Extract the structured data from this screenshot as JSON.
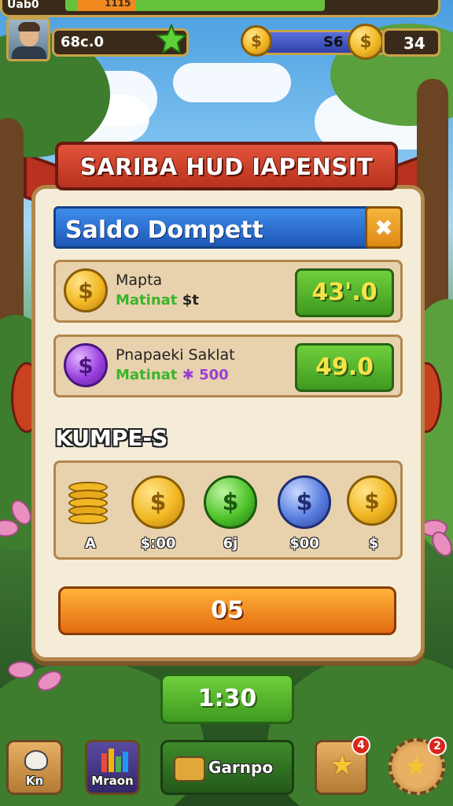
{
  "top": {
    "strip_label": "Uab0",
    "strip_value": "1115",
    "player_name": "68c.0",
    "currency_value": "S6",
    "count_value": "34"
  },
  "modal": {
    "ribbon_title": "SARIBA HUD IAPENSIT",
    "header_title": "Saldo Dompett",
    "close_label": "✖",
    "rows": [
      {
        "name": "Mapta",
        "sub_prefix": "Matinat",
        "sub_value": "$t",
        "button_value": "43'.0",
        "coin_color": "gold"
      },
      {
        "name": "Pnapaeki Saklat",
        "sub_prefix": "Matinat",
        "sub_value": "500",
        "button_value": "49.0",
        "coin_color": "purple"
      }
    ],
    "section_title": "KUMPE-S",
    "coins": [
      {
        "label": "A",
        "kind": "stack"
      },
      {
        "label": "$:00",
        "kind": "gold"
      },
      {
        "label": "6j",
        "kind": "green"
      },
      {
        "label": "$00",
        "kind": "blue"
      },
      {
        "label": "$",
        "kind": "gold"
      }
    ],
    "action_label": "05"
  },
  "timer_label": "1:30",
  "nav": {
    "items": [
      {
        "label": "Kn",
        "icon": "glove-icon"
      },
      {
        "label": "Mraon",
        "icon": "bars-icon"
      },
      {
        "label": "Garnpo",
        "icon": "chest-icon"
      },
      {
        "label": "",
        "icon": "star-icon",
        "badge": "4"
      },
      {
        "label": "",
        "icon": "star-gear-icon",
        "badge": "2"
      }
    ]
  },
  "colors": {
    "accent_gold": "#c9a24a",
    "ribbon_red": "#c8421f",
    "header_blue": "#2f6fd6",
    "button_green": "#4fae2a",
    "button_orange": "#f08a1f"
  }
}
